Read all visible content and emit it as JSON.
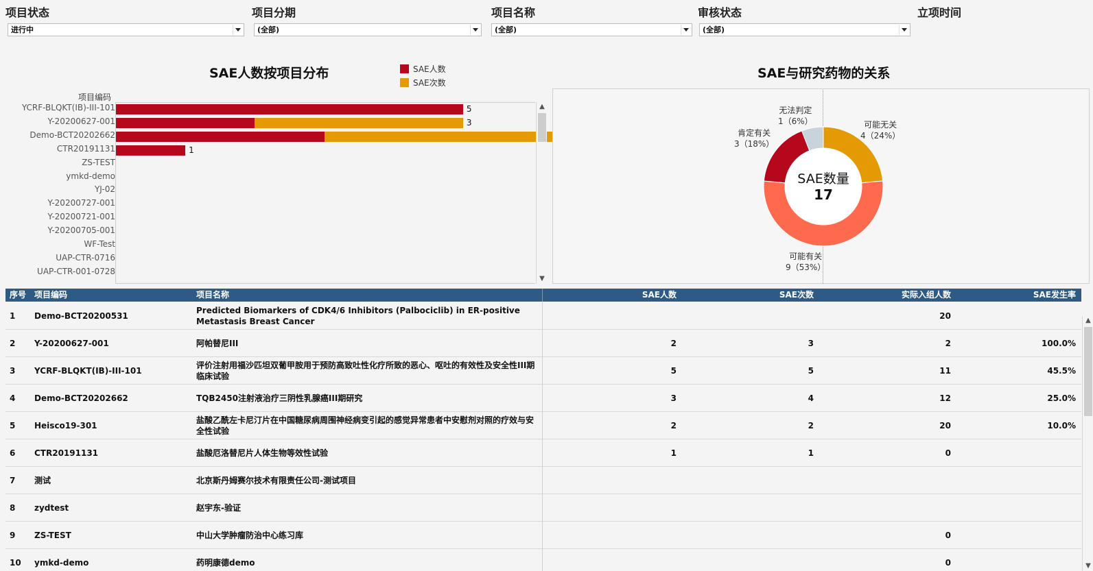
{
  "filters": [
    {
      "label": "项目状态",
      "value": "进行中"
    },
    {
      "label": "项目分期",
      "value": "(全部)"
    },
    {
      "label": "项目名称",
      "value": "(全部)"
    },
    {
      "label": "审核状态",
      "value": "(全部)"
    },
    {
      "label": "立项时间",
      "value": ""
    }
  ],
  "bar_title": "SAE人数按项目分布",
  "donut_title": "SAE与研究药物的关系",
  "colors": {
    "sae_persons": "#b5081d",
    "sae_times": "#e39a05",
    "possible_related": "#fe6a4d",
    "possibly_unrelated": "#e39a05",
    "definitely_related": "#b5081d",
    "undetermined": "#c9d3dc",
    "header_bg": "#2e5a86"
  },
  "chart_data": [
    {
      "type": "bar",
      "orientation": "horizontal",
      "stacked": true,
      "title": "SAE人数按项目分布",
      "ylabel": "项目编码",
      "categories": [
        "YCRF-BLQKT(IB)-III-101",
        "Y-20200627-001",
        "Demo-BCT20202662",
        "CTR20191131",
        "ZS-TEST",
        "ymkd-demo",
        "YJ-02",
        "Y-20200727-001",
        "Y-20200721-001",
        "Y-20200705-001",
        "WF-Test",
        "UAP-CTR-0716",
        "UAP-CTR-001-0728"
      ],
      "series": [
        {
          "name": "SAE人数",
          "values": [
            5,
            2,
            3,
            1,
            null,
            null,
            null,
            null,
            null,
            null,
            null,
            null,
            null
          ]
        },
        {
          "name": "SAE次数",
          "values": [
            null,
            3,
            4,
            null,
            null,
            null,
            null,
            null,
            null,
            null,
            null,
            null,
            null
          ]
        }
      ],
      "xlim": [
        0,
        5.98
      ],
      "legend": "top-right"
    },
    {
      "type": "pie",
      "donut": true,
      "title": "SAE与研究药物的关系",
      "center_label": "SAE数量",
      "total": 17,
      "slices": [
        {
          "name": "可能无关",
          "value": 4,
          "label": "4（24%）",
          "color": "#e39a05"
        },
        {
          "name": "可能有关",
          "value": 9,
          "label": "9（53%）",
          "color": "#fe6a4d"
        },
        {
          "name": "肯定有关",
          "value": 3,
          "label": "3（18%）",
          "color": "#b5081d"
        },
        {
          "name": "无法判定",
          "value": 1,
          "label": "1（6%）",
          "color": "#c9d3dc"
        }
      ]
    }
  ],
  "table": {
    "headers": {
      "index": "序号",
      "code": "项目编码",
      "name": "项目名称",
      "sae_persons": "SAE人数",
      "sae_times": "SAE次数",
      "enrolled": "实际入组人数",
      "rate": "SAE发生率"
    },
    "rows": [
      {
        "index": "1",
        "code": "Demo-BCT20200531",
        "name": "Predicted Biomarkers of CDK4/6 Inhibitors (Palbociclib) in ER-positive Metastasis Breast Cancer",
        "sae_persons": "",
        "sae_times": "",
        "enrolled": "20",
        "rate": ""
      },
      {
        "index": "2",
        "code": "Y-20200627-001",
        "name": "阿帕替尼III",
        "sae_persons": "2",
        "sae_times": "3",
        "enrolled": "2",
        "rate": "100.0%"
      },
      {
        "index": "3",
        "code": "YCRF-BLQKT(IB)-III-101",
        "name": "评价注射用福沙匹坦双葡甲胺用于预防高致吐性化疗所致的恶心、呕吐的有效性及安全性III期临床试验",
        "sae_persons": "5",
        "sae_times": "5",
        "enrolled": "11",
        "rate": "45.5%"
      },
      {
        "index": "4",
        "code": "Demo-BCT20202662",
        "name": "TQB2450注射液治疗三阴性乳腺癌III期研究",
        "sae_persons": "3",
        "sae_times": "4",
        "enrolled": "12",
        "rate": "25.0%"
      },
      {
        "index": "5",
        "code": "Heisco19-301",
        "name": "盐酸乙酰左卡尼汀片在中国糖尿病周围神经病变引起的感觉异常患者中安慰剂对照的疗效与安全性试验",
        "sae_persons": "2",
        "sae_times": "2",
        "enrolled": "20",
        "rate": "10.0%"
      },
      {
        "index": "6",
        "code": "CTR20191131",
        "name": "盐酸厄洛替尼片人体生物等效性试验",
        "sae_persons": "1",
        "sae_times": "1",
        "enrolled": "0",
        "rate": ""
      },
      {
        "index": "7",
        "code": "测试",
        "name": "北京斯丹姆赛尔技术有限责任公司-测试项目",
        "sae_persons": "",
        "sae_times": "",
        "enrolled": "",
        "rate": ""
      },
      {
        "index": "8",
        "code": "zydtest",
        "name": "赵宇东-验证",
        "sae_persons": "",
        "sae_times": "",
        "enrolled": "",
        "rate": ""
      },
      {
        "index": "9",
        "code": "ZS-TEST",
        "name": "中山大学肿瘤防治中心练习库",
        "sae_persons": "",
        "sae_times": "",
        "enrolled": "0",
        "rate": ""
      },
      {
        "index": "10",
        "code": "ymkd-demo",
        "name": "药明康德demo",
        "sae_persons": "",
        "sae_times": "",
        "enrolled": "0",
        "rate": ""
      }
    ]
  },
  "icons": {
    "dropdown": "chevron-down-icon",
    "scroll_up": "scroll-up-icon",
    "scroll_down": "scroll-down-icon"
  }
}
